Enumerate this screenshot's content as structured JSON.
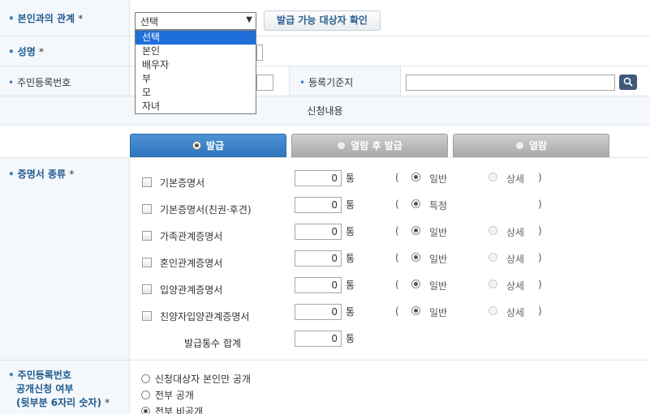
{
  "relationship": {
    "label": "본인과의 관계",
    "required": "*",
    "selected": "선택",
    "options": [
      "선택",
      "본인",
      "배우자",
      "부",
      "모",
      "자녀"
    ],
    "check_button": "발급 가능 대상자 확인"
  },
  "name": {
    "label": "성명",
    "required": "*"
  },
  "resident_no": {
    "label": "주민등록번호"
  },
  "register_base": {
    "label": "등록기준지"
  },
  "request_section": {
    "title": "신청내용"
  },
  "tabs": [
    {
      "label": "발급",
      "active": true
    },
    {
      "label": "열람 후 발급",
      "active": false
    },
    {
      "label": "열람",
      "active": false
    }
  ],
  "certificates": {
    "label": "증명서 종류",
    "required": "*",
    "unit": "통",
    "items": [
      {
        "name": "기본증명서",
        "count": "0",
        "opt1": "일반",
        "opt2": "상세"
      },
      {
        "name": "기본증명서(친권·후견)",
        "count": "0",
        "opt1": "특정",
        "opt2": ""
      },
      {
        "name": "가족관계증명서",
        "count": "0",
        "opt1": "일반",
        "opt2": "상세"
      },
      {
        "name": "혼인관계증명서",
        "count": "0",
        "opt1": "일반",
        "opt2": "상세"
      },
      {
        "name": "입양관계증명서",
        "count": "0",
        "opt1": "일반",
        "opt2": "상세"
      },
      {
        "name": "친양자입양관계증명서",
        "count": "0",
        "opt1": "일반",
        "opt2": "상세"
      }
    ],
    "total_label": "발급통수 합계",
    "total": "0"
  },
  "disclosure": {
    "label_line1": "주민등록번호",
    "label_line2": "공개신청 여부",
    "label_line3": "(뒷부분 6자리 숫자)",
    "required": "*",
    "options": [
      "신청대상자 본인만 공개",
      "전부 공개",
      "전부 비공개"
    ]
  }
}
